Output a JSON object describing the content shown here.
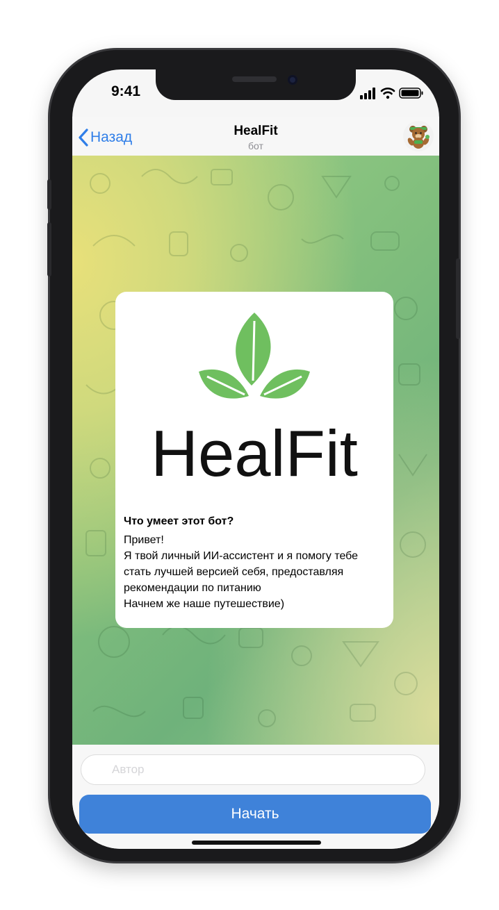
{
  "status_bar": {
    "time": "9:41"
  },
  "header": {
    "back_label": "Назад",
    "title": "HealFit",
    "subtitle": "бот"
  },
  "bot_card": {
    "logo_text": "HealFit",
    "heading": "Что умеет этот бот?",
    "lines": [
      "Привет!",
      "Я твой личный ИИ-ассистент и я помогу тебе",
      "стать лучшей версией себя, предоставляя",
      "рекомендации по питанию",
      "Начнем же наше путешествие)"
    ]
  },
  "composer": {
    "placeholder": "Автор"
  },
  "start_button": {
    "label": "Начать"
  },
  "colors": {
    "accent": "#3f82d9",
    "link": "#2f7ee8",
    "leaf_green": "#6fbf5f"
  }
}
